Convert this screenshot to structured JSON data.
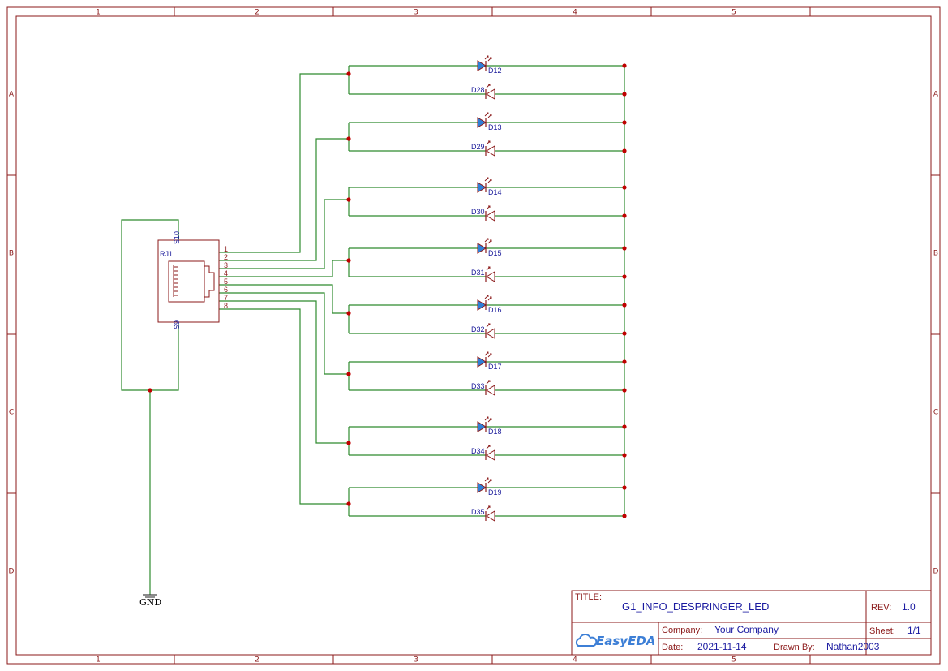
{
  "frame": {
    "col_labels": [
      "1",
      "2",
      "3",
      "4",
      "5"
    ],
    "row_labels": [
      "A",
      "B",
      "C",
      "D"
    ]
  },
  "connector": {
    "ref": "RJ1",
    "shield_top": "S10",
    "shield_bottom": "S9",
    "pins": [
      "1",
      "2",
      "3",
      "4",
      "5",
      "6",
      "7",
      "8"
    ]
  },
  "ground": {
    "label": "GND"
  },
  "leds_forward": [
    "D12",
    "D13",
    "D14",
    "D15",
    "D16",
    "D17",
    "D18",
    "D19"
  ],
  "leds_reverse": [
    "D28",
    "D29",
    "D30",
    "D31",
    "D32",
    "D33",
    "D34",
    "D35"
  ],
  "title_block": {
    "title_label": "TITLE:",
    "title": "G1_INFO_DESPRINGER_LED",
    "rev_label": "REV:",
    "rev": "1.0",
    "company_label": "Company:",
    "company": "Your Company",
    "sheet_label": "Sheet:",
    "sheet": "1/1",
    "date_label": "Date:",
    "date": "2021-11-14",
    "drawn_label": "Drawn By:",
    "drawn_by": "Nathan2003",
    "logo": "EasyEDA"
  },
  "colors": {
    "frame": "#8b1a1a",
    "wire": "#2e8b2e",
    "junction": "#c00000",
    "led_fill": "#2f7fd8",
    "text_blue": "#1a1aa0"
  }
}
